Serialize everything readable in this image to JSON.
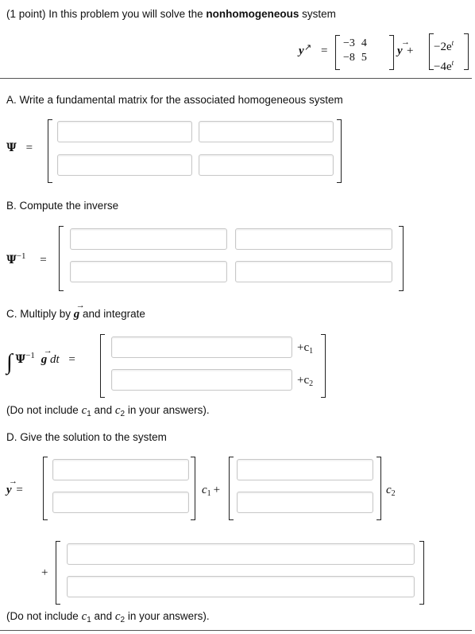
{
  "problem": {
    "intro_prefix": "(1 point) In this problem you will solve the ",
    "intro_bold": "nonhomogeneous",
    "intro_suffix": " system",
    "eq_lhs": "y",
    "eq_equals": "=",
    "matrix_A": [
      [
        "−3",
        "4"
      ],
      [
        "−8",
        "5"
      ]
    ],
    "eq_y": "y",
    "eq_plus": "+",
    "vector_g": [
      [
        "−2e",
        "t"
      ],
      [
        "−4e",
        "t"
      ]
    ]
  },
  "part_a": {
    "label": "A. Write a fundamental matrix for the associated homogeneous system",
    "lhs_symbol": "Ψ",
    "lhs_equals": "="
  },
  "part_b": {
    "label": "B. Compute the inverse",
    "lhs_symbol": "Ψ",
    "lhs_exponent": "−1",
    "lhs_equals": "="
  },
  "part_c": {
    "label_prefix": "C. Multiply by ",
    "label_vec": "g",
    "label_suffix": " and integrate",
    "integral_sign": "∫",
    "integrand_psi": "Ψ",
    "integrand_exp": "−1",
    "integrand_g": "g",
    "integrand_dt": " dt",
    "lhs_equals": "=",
    "c1_text": "+c",
    "c1_sub": "1",
    "c2_text": "+c",
    "c2_sub": "2",
    "note_prefix": "(Do not include ",
    "note_c1": "c",
    "note_c1_sub": "1",
    "note_and": " and ",
    "note_c2": "c",
    "note_c2_sub": "2",
    "note_suffix": " in your answers)."
  },
  "part_d": {
    "label": "D. Give the solution to the system",
    "lhs_y": "y",
    "lhs_equals": "=",
    "c1": "c",
    "c1_sub": "1",
    "plus": "+",
    "c2": "c",
    "c2_sub": "2",
    "plus2": "+",
    "note_prefix": "(Do not include ",
    "note_c1": "c",
    "note_c1_sub": "1",
    "note_and": " and ",
    "note_c2": "c",
    "note_c2_sub": "2",
    "note_suffix": " in your answers)."
  }
}
